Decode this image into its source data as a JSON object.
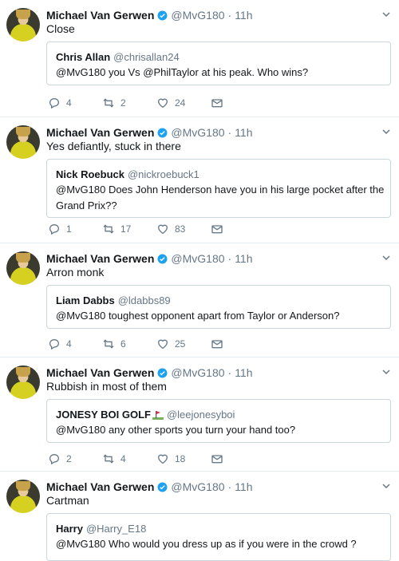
{
  "tweets": [
    {
      "name": "Michael Van Gerwen",
      "handle": "@MvG180",
      "time": "11h",
      "text": "Close",
      "quote": {
        "name": "Chris Allan",
        "handle": "@chrisallan24",
        "text": "@MvG180 you Vs @PhilTaylor at his peak. Who wins?"
      },
      "replies": "4",
      "retweets": "2",
      "likes": "24"
    },
    {
      "name": "Michael Van Gerwen",
      "handle": "@MvG180",
      "time": "11h",
      "text": "Yes defiantly, stuck in there",
      "quote": {
        "name": "Nick Roebuck",
        "handle": "@nickroebuck1",
        "text": "@MvG180 Does John Henderson have you in his large pocket after the Grand Prix??"
      },
      "replies": "1",
      "retweets": "17",
      "likes": "83"
    },
    {
      "name": "Michael Van Gerwen",
      "handle": "@MvG180",
      "time": "11h",
      "text": "Arron monk",
      "quote": {
        "name": "Liam Dabbs",
        "handle": "@ldabbs89",
        "text": "@MvG180 toughest opponent apart from Taylor or Anderson?"
      },
      "replies": "4",
      "retweets": "6",
      "likes": "25"
    },
    {
      "name": "Michael Van Gerwen",
      "handle": "@MvG180",
      "time": "11h",
      "text": "Rubbish in most of them",
      "quote": {
        "name": "JONESY BOI GOLF",
        "handle": "@leejonesyboi",
        "text": "@MvG180 any other sports you turn your hand too?"
      },
      "replies": "2",
      "retweets": "4",
      "likes": "18"
    },
    {
      "name": "Michael Van Gerwen",
      "handle": "@MvG180",
      "time": "11h",
      "text": "Cartman",
      "quote": {
        "name": "Harry",
        "handle": "@Harry_E18",
        "text": "@MvG180 Who would you dress up as if you were in the crowd ?"
      }
    }
  ],
  "colors": {
    "verified": "#1da1f2",
    "secondary": "#657786",
    "border": "#ccd6dd"
  },
  "icons": [
    "verified-badge-icon",
    "chevron-down-icon",
    "reply-icon",
    "retweet-icon",
    "like-icon",
    "direct-message-icon",
    "golf-flag-emoji-icon"
  ]
}
